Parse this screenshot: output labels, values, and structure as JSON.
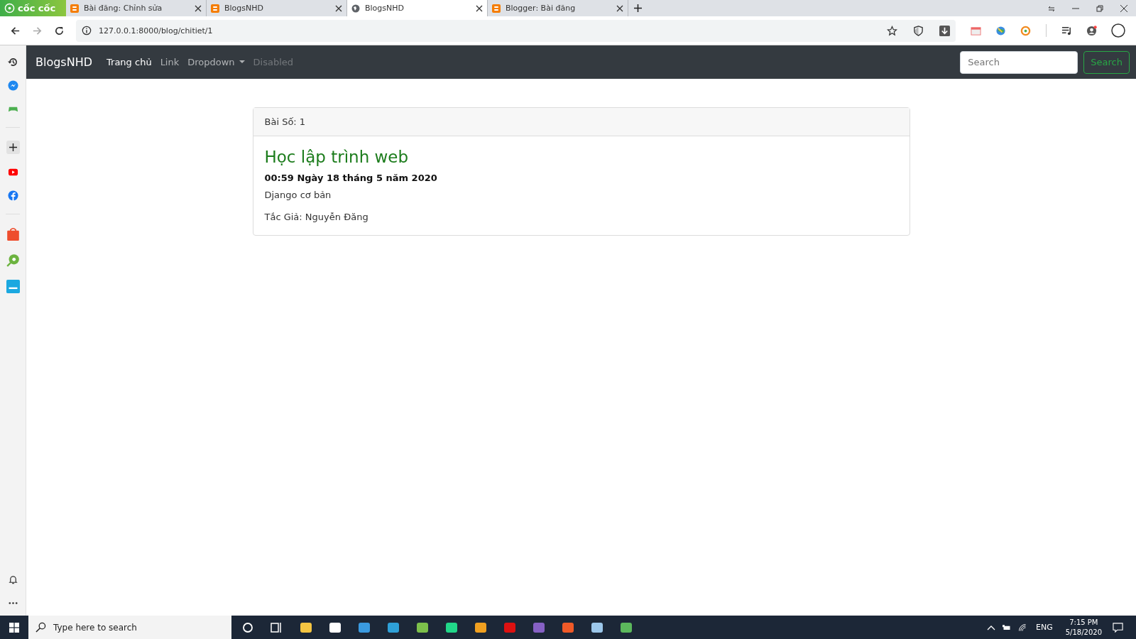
{
  "browser": {
    "logo": "cốc cốc",
    "tabs": [
      {
        "title": "Bài đăng: Chỉnh sửa",
        "kind": "blogger",
        "selected": false
      },
      {
        "title": "BlogsNHD",
        "kind": "blogger",
        "selected": false
      },
      {
        "title": "BlogsNHD",
        "kind": "globe",
        "selected": true
      },
      {
        "title": "Blogger: Bài đăng",
        "kind": "blogger",
        "selected": false
      }
    ],
    "url": "127.0.0.1:8000/blog/chitiet/1"
  },
  "navbar": {
    "brand": "BlogsNHD",
    "links": [
      {
        "label": "Trang chủ",
        "selected": true,
        "disabled": false,
        "dropdown": false
      },
      {
        "label": "Link",
        "selected": false,
        "disabled": false,
        "dropdown": false
      },
      {
        "label": "Dropdown",
        "selected": false,
        "disabled": false,
        "dropdown": true
      },
      {
        "label": "Disabled",
        "selected": false,
        "disabled": true,
        "dropdown": false
      }
    ],
    "search": {
      "placeholder": "Search"
    },
    "search_button": "Search"
  },
  "card": {
    "header": "Bài Số: 1",
    "title": "Học lập trình web",
    "date": "00:59 Ngày 18 tháng 5 năm 2020",
    "body": "Django cơ bản",
    "author": "Tắc Giả: Nguyễn Đăng"
  },
  "taskbar": {
    "search": {
      "placeholder": "Type here to search"
    },
    "language": "ENG",
    "time": "7:15 PM",
    "date": "5/18/2020"
  }
}
